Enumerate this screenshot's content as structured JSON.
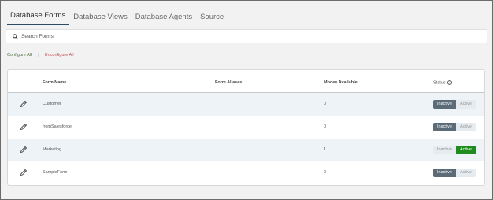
{
  "tabs": [
    {
      "label": "Database Forms",
      "active": true
    },
    {
      "label": "Database Views",
      "active": false
    },
    {
      "label": "Database Agents",
      "active": false
    },
    {
      "label": "Source",
      "active": false
    }
  ],
  "search": {
    "placeholder": "Search Forms",
    "value": ""
  },
  "actions": {
    "configure_all": "Configure All",
    "separator": "|",
    "unconfigure_all": "Unconfigure All"
  },
  "table": {
    "headers": {
      "form_name": "Form Name",
      "form_aliases": "Form Aliases",
      "modes_available": "Modes Available",
      "status": "Status"
    },
    "status_options": {
      "inactive": "Inactive",
      "active": "Active"
    },
    "rows": [
      {
        "form_name": "Customer",
        "form_aliases": "",
        "modes_available": "0",
        "status": "Inactive"
      },
      {
        "form_name": "fromSalesforce",
        "form_aliases": "",
        "modes_available": "0",
        "status": "Inactive"
      },
      {
        "form_name": "Marketing",
        "form_aliases": "",
        "modes_available": "1",
        "status": "Active"
      },
      {
        "form_name": "SampleForm",
        "form_aliases": "",
        "modes_available": "0",
        "status": "Inactive"
      }
    ]
  },
  "colors": {
    "active_tab_underline": "#2b4a66",
    "configure_link": "#4a6b3b",
    "unconfigure_link": "#c0504d",
    "status_inactive_selected": "#5b6b78",
    "status_active_selected": "#1e8c1e",
    "row_stripe": "#eef3f8"
  }
}
